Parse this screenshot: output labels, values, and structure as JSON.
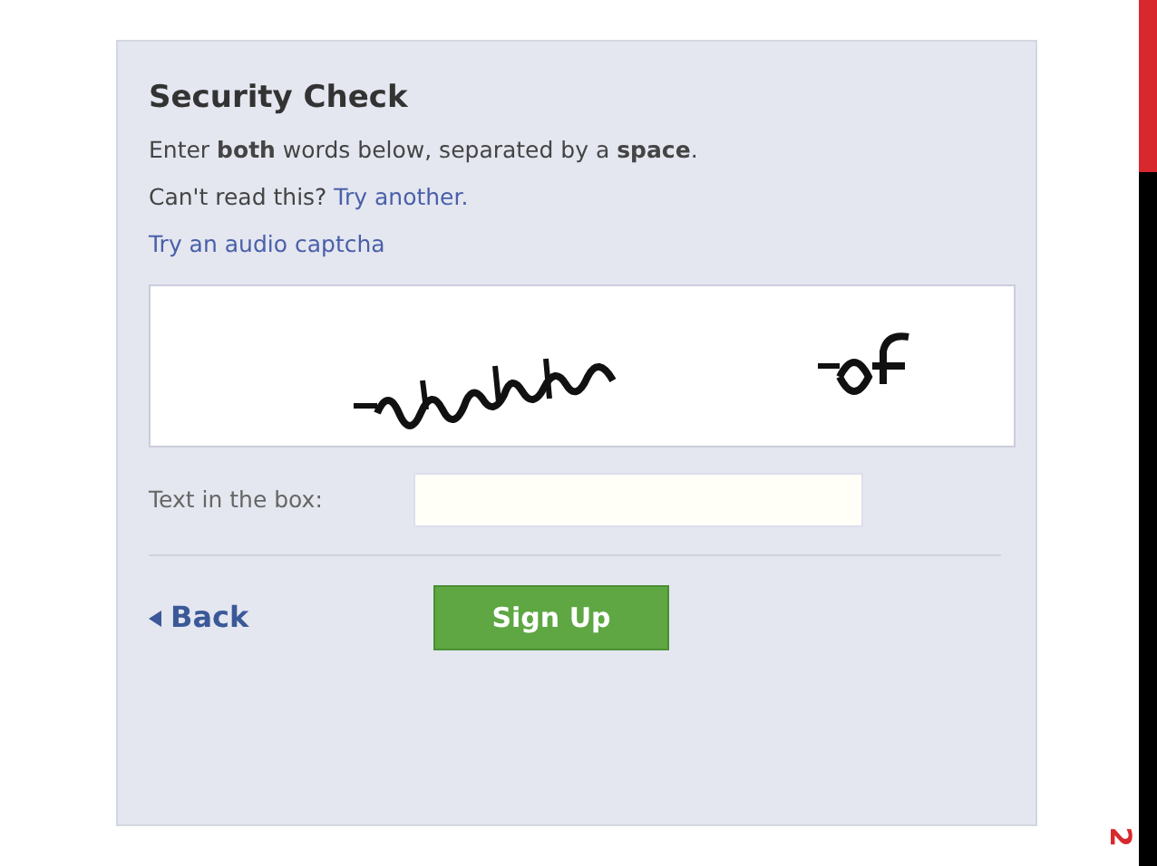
{
  "dialog": {
    "title": "Security Check",
    "instructions": "Enter **both** words below, separated by a **space**.",
    "help_text": "Can't read this?",
    "help_link": "Try another.",
    "audio_link": "Try an audio captcha",
    "answer_label": "Text in the box:",
    "back_link": "Back",
    "submit_button": "Sign Up"
  },
  "slide_number": "2"
}
